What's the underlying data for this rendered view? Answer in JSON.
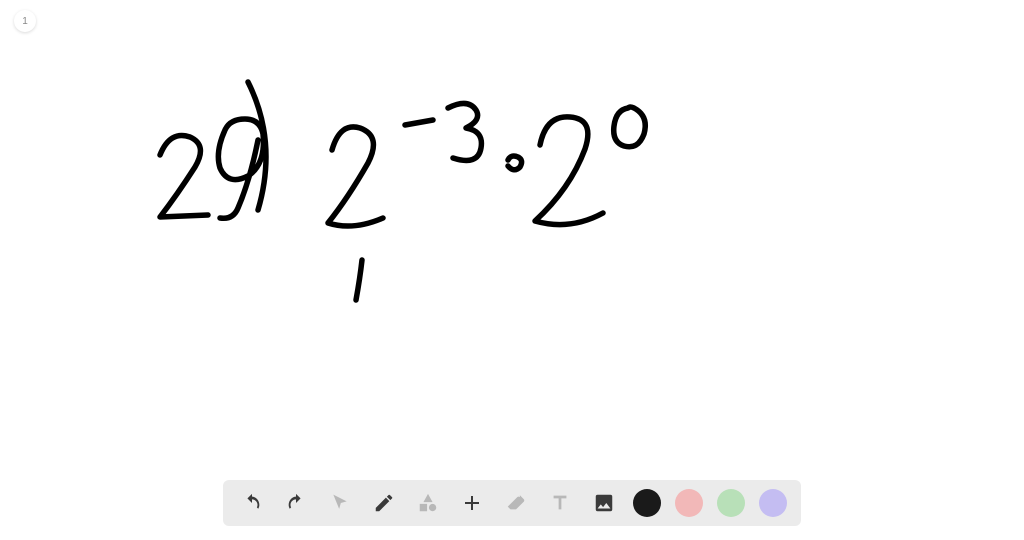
{
  "page": {
    "number": "1"
  },
  "handwriting": {
    "problem_number": "29",
    "expression": "2^{-3} · 2^{0}",
    "partial_mark": "1"
  },
  "toolbar": {
    "tools": {
      "undo": "undo",
      "redo": "redo",
      "pointer": "pointer",
      "pencil": "pencil",
      "shapes": "shapes",
      "plus": "add",
      "eraser": "eraser",
      "text": "text",
      "image": "image"
    },
    "colors": {
      "black": "#1a1a1a",
      "pink": "#f2b8b8",
      "green": "#b8e0b8",
      "purple": "#c4bdf2"
    }
  }
}
